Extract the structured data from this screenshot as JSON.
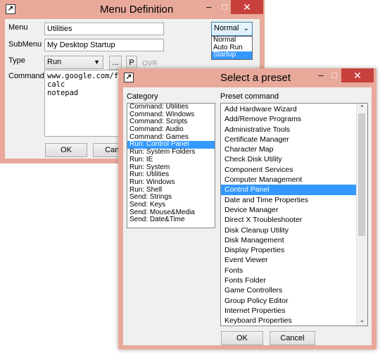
{
  "menu_def": {
    "title": "Menu Definition",
    "minimize": "–",
    "maximize": "□",
    "close": "✕",
    "labels": {
      "menu": "Menu",
      "submenu": "SubMenu",
      "type": "Type",
      "command": "Command"
    },
    "menu_value": "Utilities",
    "submenu_value": "My Desktop Startup",
    "type_value": "Run",
    "browse_label": "...",
    "p_label": "P",
    "ovr_label": "OVR",
    "command_lines": [
      "www.google.com/fi",
      "calc",
      "notepad"
    ],
    "ok_label": "OK",
    "cancel_label": "Canc",
    "mode_selected": "Normal",
    "mode_options": [
      "Normal",
      "Auto Run",
      "Startup"
    ],
    "mode_highlighted": "Startup"
  },
  "preset": {
    "title": "Select a preset",
    "minimize": "–",
    "maximize": "□",
    "close": "✕",
    "category_label": "Category",
    "preset_label": "Preset command",
    "categories": [
      "Command:  Utilities",
      "Command:  Windows",
      "Command:  Scripts",
      "Command:  Audio",
      "Command:  Games",
      "Run:  Control Panel",
      "Run:  System Folders",
      "Run:  IE",
      "Run:  System",
      "Run:  Utilities",
      "Run:  Windows",
      "Run:  Shell",
      "Send:  Strings",
      "Send:  Keys",
      "Send:  Mouse&Media",
      "Send:  Date&Time"
    ],
    "category_selected": "Run:  Control Panel",
    "presets": [
      "Add Hardware Wizard",
      "Add/Remove Programs",
      "Administrative Tools",
      "Certificate Manager",
      "Character Map",
      "Check Disk Utility",
      "Component Services",
      "Computer Management",
      "Control Panel",
      "Date and Time Properties",
      "Device Manager",
      "Direct X Troubleshooter",
      "Disk Cleanup Utility",
      "Disk Management",
      "Display Properties",
      "Event Viewer",
      "Fonts",
      "Fonts Folder",
      "Game Controllers",
      "Group Policy Editor",
      "Internet Properties",
      "Keyboard Properties"
    ],
    "preset_selected": "Control Panel",
    "ok_label": "OK",
    "cancel_label": "Cancel"
  },
  "colors": {
    "frame": "#e8a99a",
    "close": "#c7403b",
    "selection": "#3399ff",
    "body": "#f0f0f0"
  }
}
